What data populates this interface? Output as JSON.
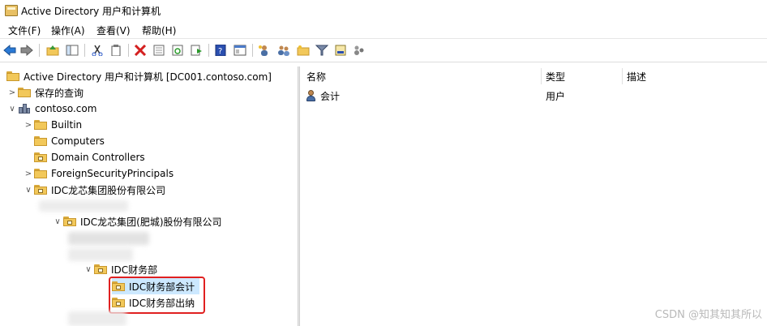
{
  "window": {
    "title": "Active Directory 用户和计算机"
  },
  "menu": [
    "文件(F)",
    "操作(A)",
    "查看(V)",
    "帮助(H)"
  ],
  "toolbar": [
    "back-icon",
    "forward-icon",
    "up-folder-icon",
    "show-tree-icon",
    "cut-icon",
    "paste-icon",
    "delete-icon",
    "properties-icon",
    "refresh-icon",
    "export-icon",
    "help-icon",
    "console-icon",
    "new-user-icon",
    "new-group-icon",
    "new-ou-icon",
    "filter-icon",
    "find-icon",
    "delegate-icon"
  ],
  "tree": {
    "root": "Active Directory 用户和计算机 [DC001.contoso.com]",
    "saved_queries": "保存的查询",
    "domain": "contoso.com",
    "builtin": "Builtin",
    "computers": "Computers",
    "domain_controllers": "Domain Controllers",
    "fsp": "ForeignSecurityPrincipals",
    "ou_group": "IDC龙芯集团股份有限公司",
    "ou_hefei": "IDC龙芯集团(肥城)股份有限公司",
    "ou_finance": "IDC财务部",
    "ou_accounting": "IDC财务部会计",
    "ou_cashier": "IDC财务部出纳"
  },
  "list": {
    "columns": [
      "名称",
      "类型",
      "描述"
    ],
    "rows": [
      {
        "name": "会计",
        "type": "用户",
        "description": ""
      }
    ]
  },
  "watermark": "CSDN @知其知其所以"
}
